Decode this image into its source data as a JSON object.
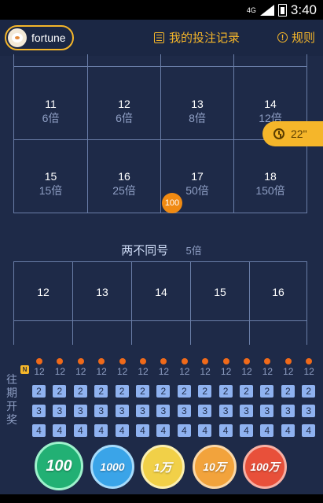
{
  "status": {
    "network": "4G",
    "time": "3:40"
  },
  "header": {
    "username": "fortune",
    "records_label": "我的投注记录",
    "rules_label": "规则"
  },
  "sum_bets": {
    "row1": [
      {
        "num": "11",
        "odds": "6倍"
      },
      {
        "num": "12",
        "odds": "6倍"
      },
      {
        "num": "13",
        "odds": "8倍"
      },
      {
        "num": "14",
        "odds": "12倍"
      }
    ],
    "row2": [
      {
        "num": "15",
        "odds": "15倍"
      },
      {
        "num": "16",
        "odds": "25倍"
      },
      {
        "num": "17",
        "odds": "50倍"
      },
      {
        "num": "18",
        "odds": "150倍"
      }
    ]
  },
  "timer": {
    "value": "22\""
  },
  "placed_chip": {
    "value": "100"
  },
  "two_different": {
    "title": "两不同号",
    "multiplier": "5倍",
    "items": [
      "12",
      "13",
      "14",
      "15",
      "16"
    ]
  },
  "history": {
    "label": "往期开奖",
    "badge": "N",
    "sums": [
      "12",
      "12",
      "12",
      "12",
      "12",
      "12",
      "12",
      "12",
      "12",
      "12",
      "12",
      "12",
      "12",
      "12"
    ],
    "row_a": [
      "2",
      "2",
      "2",
      "2",
      "2",
      "2",
      "2",
      "2",
      "2",
      "2",
      "2",
      "2",
      "2",
      "2"
    ],
    "row_b": [
      "3",
      "3",
      "3",
      "3",
      "3",
      "3",
      "3",
      "3",
      "3",
      "3",
      "3",
      "3",
      "3",
      "3"
    ],
    "row_c": [
      "4",
      "4",
      "4",
      "4",
      "4",
      "4",
      "4",
      "4",
      "4",
      "4",
      "4",
      "4",
      "4",
      "4"
    ]
  },
  "chips": [
    "100",
    "1000",
    "1万",
    "10万",
    "100万"
  ],
  "colors": {
    "accent": "#f5b62a",
    "background": "#1e2a48",
    "grid_line": "#6a7ea8"
  }
}
